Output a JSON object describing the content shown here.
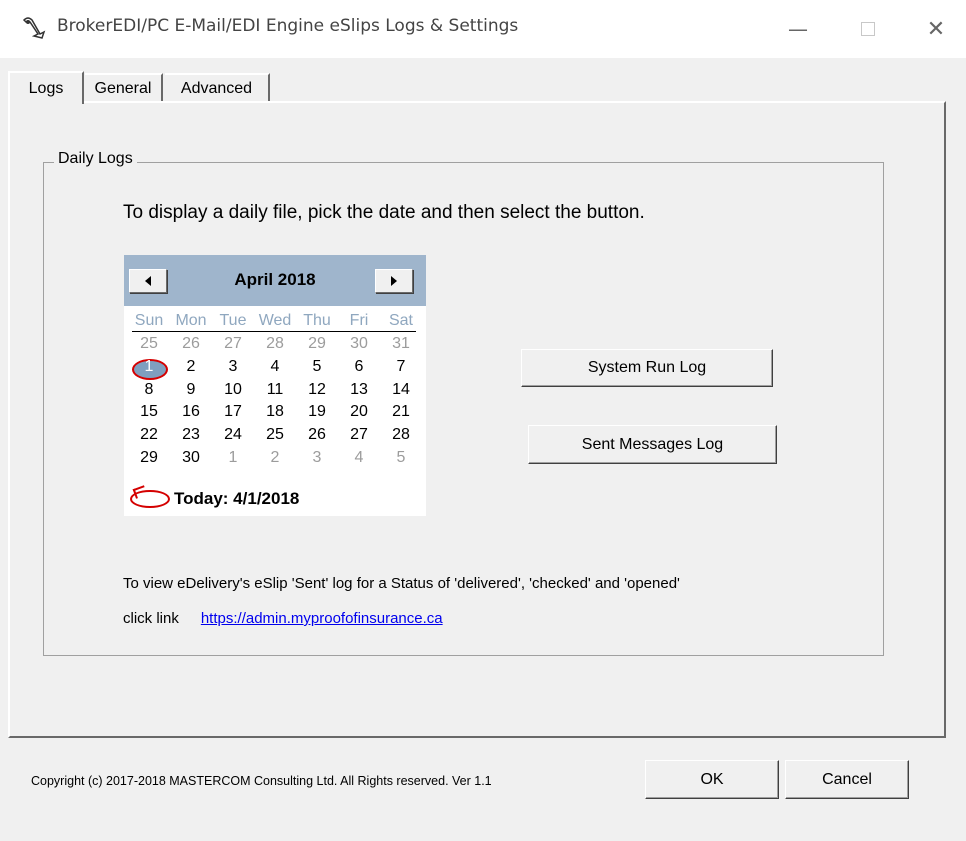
{
  "window": {
    "title": "BrokerEDI/PC E-Mail/EDI Engine eSlips Logs & Settings",
    "minimize_glyph": "—",
    "close_glyph": "✕"
  },
  "tabs": [
    {
      "label": "Logs",
      "selected": true
    },
    {
      "label": "General",
      "selected": false
    },
    {
      "label": "Advanced",
      "selected": false
    }
  ],
  "daily_logs": {
    "group_label": "Daily Logs",
    "instructions": "To display a daily file, pick the date and then select the button.",
    "calendar": {
      "month_label": "April 2018",
      "day_headers": [
        "Sun",
        "Mon",
        "Tue",
        "Wed",
        "Thu",
        "Fri",
        "Sat"
      ],
      "weeks": [
        [
          "25",
          "26",
          "27",
          "28",
          "29",
          "30",
          "31"
        ],
        [
          "1",
          "2",
          "3",
          "4",
          "5",
          "6",
          "7"
        ],
        [
          "8",
          "9",
          "10",
          "11",
          "12",
          "13",
          "14"
        ],
        [
          "15",
          "16",
          "17",
          "18",
          "19",
          "20",
          "21"
        ],
        [
          "22",
          "23",
          "24",
          "25",
          "26",
          "27",
          "28"
        ],
        [
          "29",
          "30",
          "1",
          "2",
          "3",
          "4",
          "5"
        ]
      ],
      "today_label": "Today: 4/1/2018",
      "accent_color": "#9fb5cc",
      "today_marker_color": "#d40000"
    },
    "buttons": {
      "system_run_log": "System Run Log",
      "sent_messages_log": "Sent Messages Log"
    },
    "note": "To view eDelivery's eSlip 'Sent' log for a Status of 'delivered', 'checked' and  'opened'",
    "link_prefix": "click link",
    "link_url": "https://admin.myproofofinsurance.ca"
  },
  "footer": {
    "copyright": "Copyright (c) 2017-2018 MASTERCOM Consulting Ltd. All Rights reserved. Ver 1.1",
    "ok_label": "OK",
    "cancel_label": "Cancel"
  }
}
